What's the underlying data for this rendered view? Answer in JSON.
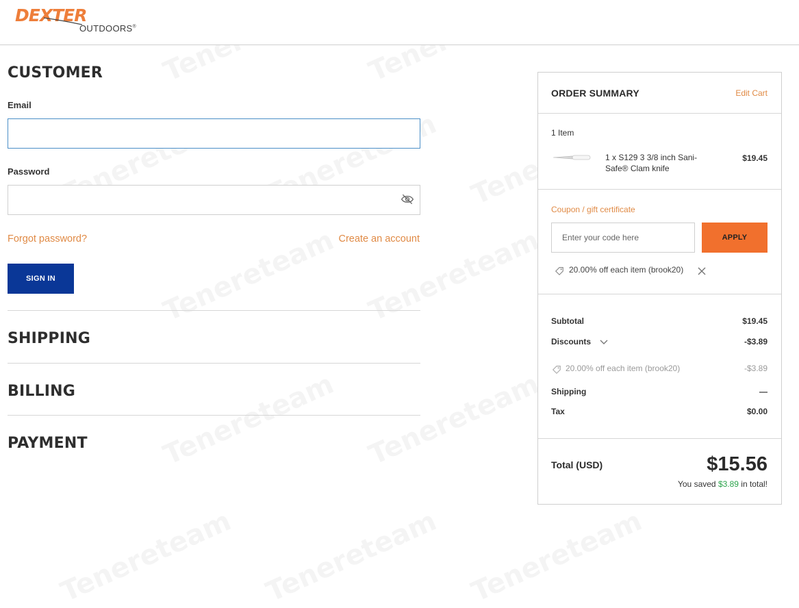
{
  "brand": {
    "name": "DEXTER",
    "sub": "OUTDOORS",
    "mark": "®"
  },
  "customer": {
    "heading": "CUSTOMER",
    "email_label": "Email",
    "email_value": "",
    "password_label": "Password",
    "password_value": "",
    "forgot_link": "Forgot password?",
    "create_link": "Create an account",
    "signin_button": "SIGN IN"
  },
  "sections": {
    "shipping": "SHIPPING",
    "billing": "BILLING",
    "payment": "PAYMENT"
  },
  "summary": {
    "title": "ORDER SUMMARY",
    "edit_cart": "Edit Cart",
    "item_count": "1 Item",
    "item": {
      "name": "1 x S129 3 3/8 inch Sani-Safe® Clam knife",
      "price": "$19.45"
    },
    "coupon": {
      "label": "Coupon / gift certificate",
      "placeholder": "Enter your code here",
      "apply_button": "APPLY",
      "applied_text": "20.00% off each item (brook20)"
    },
    "rows": {
      "subtotal_label": "Subtotal",
      "subtotal_value": "$19.45",
      "discounts_label": "Discounts",
      "discounts_value": "-$3.89",
      "discount_detail_label": "20.00% off each item (brook20)",
      "discount_detail_value": "-$3.89",
      "shipping_label": "Shipping",
      "shipping_value": "—",
      "tax_label": "Tax",
      "tax_value": "$0.00"
    },
    "total_label": "Total (USD)",
    "total_value": "$15.56",
    "saved_prefix": "You saved ",
    "saved_amount": "$3.89",
    "saved_suffix": " in total!"
  },
  "watermark": "Tenereteam",
  "colors": {
    "accent_orange": "#f1702d",
    "link_orange": "#e08a45",
    "signin_blue": "#0a3797",
    "savings_green": "#2aa34a"
  }
}
